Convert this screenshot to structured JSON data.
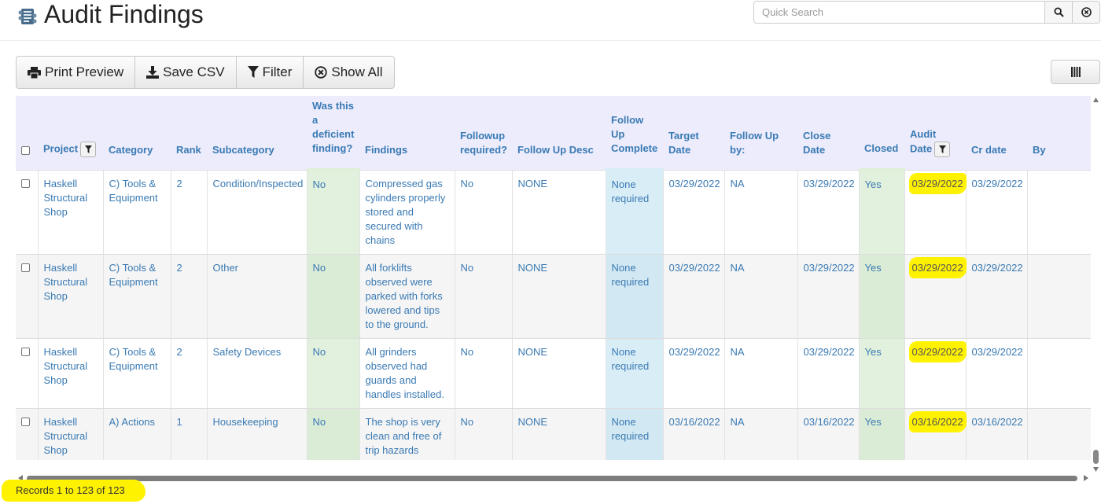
{
  "header": {
    "title": "Audit Findings",
    "search_placeholder": "Quick Search"
  },
  "toolbar": {
    "print_preview": "Print Preview",
    "save_csv": "Save CSV",
    "filter": "Filter",
    "show_all": "Show All"
  },
  "table": {
    "columns": {
      "project": "Project",
      "category": "Category",
      "rank": "Rank",
      "subcategory": "Subcategory",
      "deficient": "Was this a deficient finding?",
      "findings": "Findings",
      "followup_required": "Followup required?",
      "followup_desc": "Follow Up Desc",
      "followup_complete": "Follow Up Complete",
      "target_date": "Target Date",
      "followup_by": "Follow Up by:",
      "close_date": "Close Date",
      "closed": "Closed",
      "audit_date": "Audit Date",
      "cr_date": "Cr date",
      "by": "By"
    },
    "rows": [
      {
        "project": "Haskell Structural Shop",
        "category": "C) Tools & Equipment",
        "rank": "2",
        "subcategory": "Condition/Inspected",
        "deficient": "No",
        "findings": "Compressed gas cylinders properly stored and secured with chains",
        "followup_required": "No",
        "followup_desc": "NONE",
        "followup_complete": "None required",
        "target_date": "03/29/2022",
        "followup_by": "NA",
        "close_date": "03/29/2022",
        "closed": "Yes",
        "audit_date": "03/29/2022",
        "cr_date": "03/29/2022",
        "by": ""
      },
      {
        "project": "Haskell Structural Shop",
        "category": "C) Tools & Equipment",
        "rank": "2",
        "subcategory": "Other",
        "deficient": "No",
        "findings": "All forklifts observed were parked with forks lowered and tips to the ground.",
        "followup_required": "No",
        "followup_desc": "NONE",
        "followup_complete": "None required",
        "target_date": "03/29/2022",
        "followup_by": "NA",
        "close_date": "03/29/2022",
        "closed": "Yes",
        "audit_date": "03/29/2022",
        "cr_date": "03/29/2022",
        "by": ""
      },
      {
        "project": "Haskell Structural Shop",
        "category": "C) Tools & Equipment",
        "rank": "2",
        "subcategory": "Safety Devices",
        "deficient": "No",
        "findings": "All grinders observed had guards and handles installed.",
        "followup_required": "No",
        "followup_desc": "NONE",
        "followup_complete": "None required",
        "target_date": "03/29/2022",
        "followup_by": "NA",
        "close_date": "03/29/2022",
        "closed": "Yes",
        "audit_date": "03/29/2022",
        "cr_date": "03/29/2022",
        "by": ""
      },
      {
        "project": "Haskell Structural Shop",
        "category": "A) Actions",
        "rank": "1",
        "subcategory": "Housekeeping",
        "deficient": "No",
        "findings": "The shop is very clean and free of trip hazards",
        "followup_required": "No",
        "followup_desc": "NONE",
        "followup_complete": "None required",
        "target_date": "03/16/2022",
        "followup_by": "NA",
        "close_date": "03/16/2022",
        "closed": "Yes",
        "audit_date": "03/16/2022",
        "cr_date": "03/16/2022",
        "by": ""
      }
    ]
  },
  "footer": {
    "records": "Records 1 to 123 of 123"
  },
  "colors": {
    "link": "#3a7ab3",
    "header_bg": "#ececfc",
    "highlight": "#fff200",
    "green_col": "#e2f1de",
    "blue_col": "#d9edf7"
  }
}
